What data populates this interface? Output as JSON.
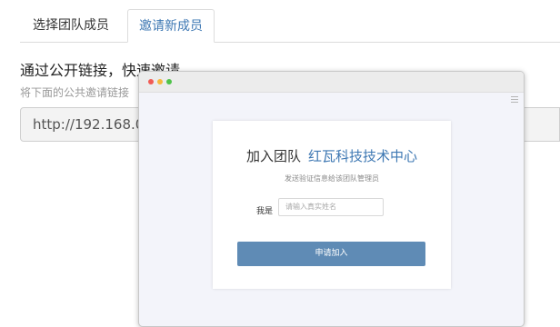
{
  "tabs": [
    {
      "label": "选择团队成员",
      "active": false
    },
    {
      "label": "邀请新成员",
      "active": true
    }
  ],
  "invite": {
    "heading": "通过公开链接，快速邀请",
    "subtext": "将下面的公共邀请链接",
    "url": "http://192.168.0.1"
  },
  "preview": {
    "title_prefix": "加入团队",
    "org_name": "红瓦科技技术中心",
    "description": "发送验证信息给该团队管理员",
    "name_label": "我是",
    "name_placeholder": "请输入真实姓名",
    "apply_button": "申请加入"
  },
  "colors": {
    "accent": "#3e78b3",
    "button": "#5f8bb5",
    "traffic_red": "#f15b54",
    "traffic_yellow": "#f5b93c",
    "traffic_green": "#4fc34a"
  }
}
